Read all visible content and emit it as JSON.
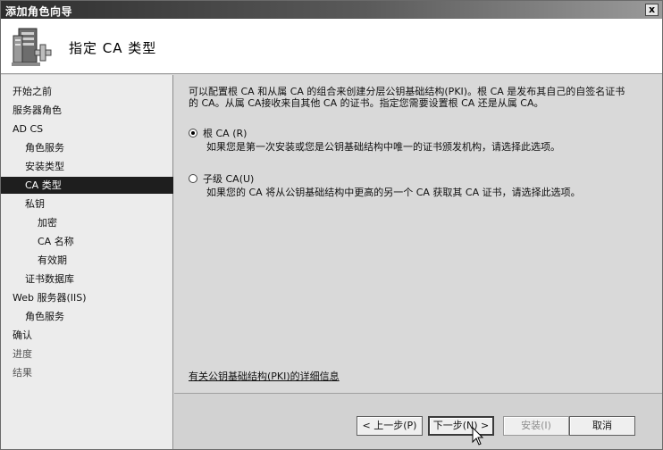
{
  "window": {
    "title": "添加角色向导",
    "close_label": "x"
  },
  "header": {
    "title": "指定 CA 类型",
    "icon": "server-role-wizard-icon"
  },
  "sidebar": {
    "items": [
      {
        "label": "开始之前",
        "level": 0,
        "state": "normal"
      },
      {
        "label": "服务器角色",
        "level": 0,
        "state": "normal"
      },
      {
        "label": "AD CS",
        "level": 0,
        "state": "normal"
      },
      {
        "label": "角色服务",
        "level": 1,
        "state": "normal"
      },
      {
        "label": "安装类型",
        "level": 1,
        "state": "normal"
      },
      {
        "label": "CA 类型",
        "level": 1,
        "state": "active"
      },
      {
        "label": "私钥",
        "level": 1,
        "state": "normal"
      },
      {
        "label": "加密",
        "level": 2,
        "state": "normal"
      },
      {
        "label": "CA 名称",
        "level": 2,
        "state": "normal"
      },
      {
        "label": "有效期",
        "level": 2,
        "state": "normal"
      },
      {
        "label": "证书数据库",
        "level": 1,
        "state": "normal"
      },
      {
        "label": "Web 服务器(IIS)",
        "level": 0,
        "state": "normal"
      },
      {
        "label": "角色服务",
        "level": 1,
        "state": "normal"
      },
      {
        "label": "确认",
        "level": 0,
        "state": "normal"
      },
      {
        "label": "进度",
        "level": 0,
        "state": "dim"
      },
      {
        "label": "结果",
        "level": 0,
        "state": "dim"
      }
    ]
  },
  "main": {
    "description_line1": "可以配置根 CA 和从属 CA 的组合来创建分层公钥基础结构(PKI)。根 CA 是发布其自己的自签名证书",
    "description_line2": "的 CA。从属 CA接收来自其他 CA 的证书。指定您需要设置根 CA 还是从属 CA。",
    "options": [
      {
        "label": "根 CA (R)",
        "description": "如果您是第一次安装或您是公钥基础结构中唯一的证书颁发机构，请选择此选项。",
        "checked": true
      },
      {
        "label": "子级 CA(U)",
        "description": "如果您的 CA 将从公钥基础结构中更高的另一个 CA 获取其 CA 证书，请选择此选项。",
        "checked": false
      }
    ],
    "info_link": "有关公钥基础结构(PKI)的详细信息"
  },
  "footer": {
    "back_label": "< 上一步(P)",
    "next_label": "下一步(N) >",
    "install_label": "安装(I)",
    "cancel_label": "取消"
  }
}
